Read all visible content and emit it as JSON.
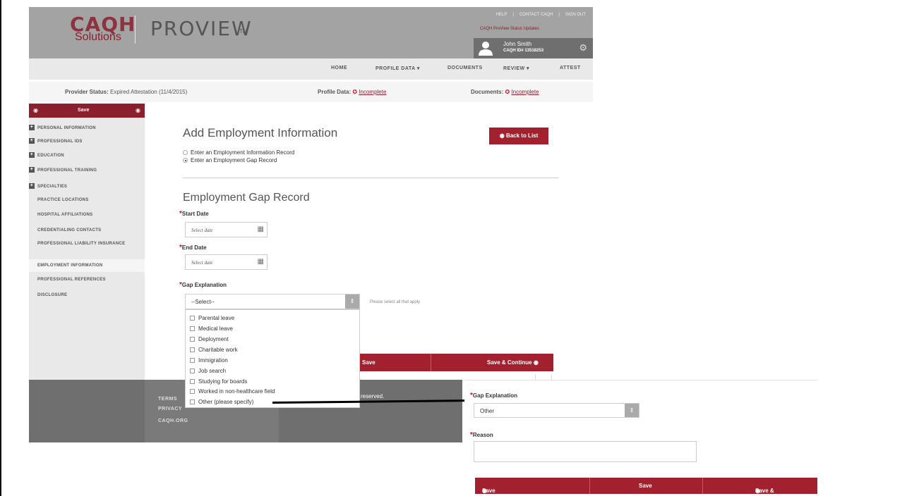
{
  "header": {
    "logo_caqh": "CAQH",
    "logo_solutions": "Solutions",
    "logo_proview": "PROVIEW",
    "logo_tm": "TM",
    "top_links": [
      "HELP",
      "CONTACT CAQH",
      "SIGN OUT"
    ],
    "top_link_separator": "|",
    "status_updates_link": "CAQH ProView Status Updates",
    "user_name": "John Smith",
    "user_id": "CAQH ID# 13518253"
  },
  "nav": {
    "items": [
      "HOME",
      "PROFILE DATA ▾",
      "DOCUMENTS",
      "REVIEW ▾",
      "ATTEST"
    ]
  },
  "status_bar": {
    "provider_status_label": "Provider Status:",
    "provider_status_value": "Expired Attestation (11/4/2015)",
    "profile_data_label": "Profile Data:",
    "profile_data_value": "Incomplete",
    "documents_label": "Documents:",
    "documents_value": "Incomplete"
  },
  "sidebar": {
    "save_label": "Save",
    "items": [
      {
        "label": "PERSONAL INFORMATION",
        "expandable": true
      },
      {
        "label": "PROFESSIONAL IDS",
        "expandable": true
      },
      {
        "label": "EDUCATION",
        "expandable": true
      },
      {
        "label": "PROFESSIONAL TRAINING",
        "expandable": true
      },
      {
        "label": "SPECIALTIES",
        "expandable": true
      },
      {
        "label": "PRACTICE LOCATIONS",
        "expandable": false
      },
      {
        "label": "HOSPITAL AFFILIATIONS",
        "expandable": false
      },
      {
        "label": "CREDENTIALING CONTACTS",
        "expandable": false
      },
      {
        "label": "PROFESSIONAL LIABILITY INSURANCE",
        "expandable": false
      },
      {
        "label": "EMPLOYMENT INFORMATION",
        "expandable": false,
        "active": true
      },
      {
        "label": "PROFESSIONAL REFERENCES",
        "expandable": false
      },
      {
        "label": "DISCLOSURE",
        "expandable": false
      }
    ]
  },
  "main": {
    "title": "Add Employment Information",
    "back_button": "Back to List",
    "radio_options": [
      "Enter an Employment Information Record",
      "Enter an Employment Gap Record"
    ],
    "radio_selected": 1,
    "section_title": "Employment Gap Record",
    "start_date_label": "Start Date",
    "end_date_label": "End Date",
    "date_placeholder": "Select date",
    "gap_label": "Gap Explanation",
    "gap_select_value": "--Select--",
    "gap_hint": "Please select all that apply",
    "gap_options": [
      "Parental leave",
      "Medical leave",
      "Deployment",
      "Charitable work",
      "Immigration",
      "Job search",
      "Studying for boards",
      "Worked in non-healthcare field",
      "Other (please specify)"
    ],
    "save_label": "Save",
    "save_continue_label": "Save & Continue"
  },
  "footer": {
    "links": [
      "TERMS",
      "PRIVACY",
      "CAQH.ORG"
    ],
    "reserved": "reserved."
  },
  "inset": {
    "gap_label": "Gap Explanation",
    "gap_value": "Other",
    "reason_label": "Reason",
    "save_go_back": "Save and Go Back",
    "save": "Save",
    "save_continue": "Save & Continue"
  },
  "colors": {
    "brand_red": "#a3202f",
    "header_gray": "#a3a3a3",
    "footer_gray": "#6f6f6f"
  }
}
